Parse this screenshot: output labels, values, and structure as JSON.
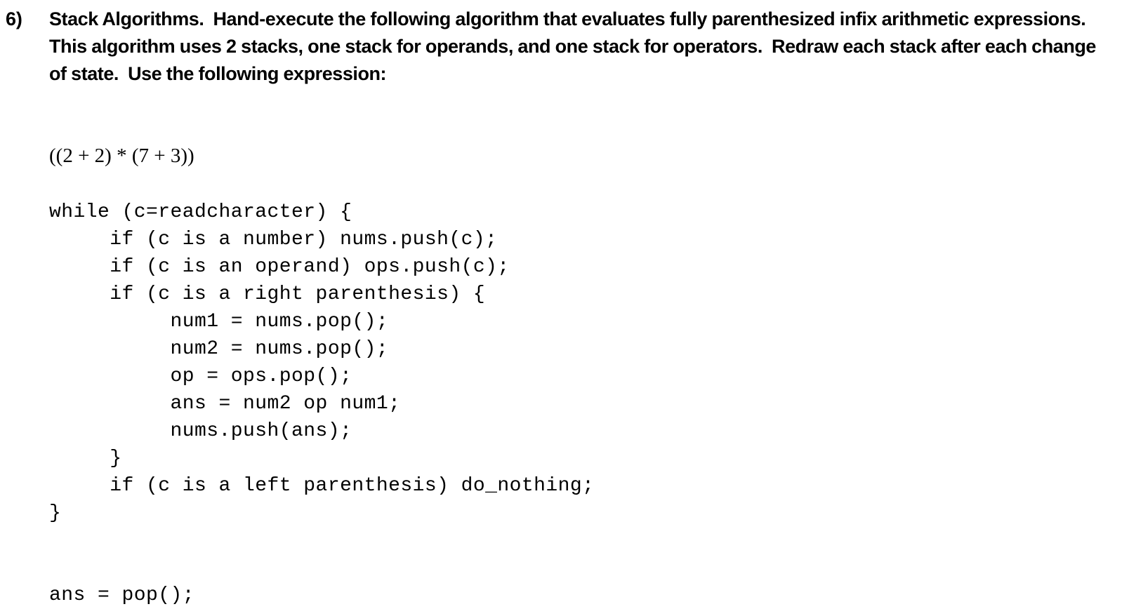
{
  "page": {
    "background_color": "#ffffff",
    "text_color": "#000000"
  },
  "question": {
    "number_label": "6)",
    "prompt": "Stack Algorithms.  Hand-execute the following algorithm that evaluates fully parenthesized infix arithmetic expressions.  This algorithm uses 2 stacks, one stack for operands, and one stack for operators.  Redraw each stack after each change of state.  Use the following expression:",
    "prompt_lines": [
      "Stack Algorithms.  Hand-execute the following algorithm that evaluates fully parenthesized",
      "infix arithmetic expressions.  This algorithm uses 2 stacks, one stack for operands, and one",
      "stack for operators.  Redraw each stack after each change of state.  Use the following",
      "expression:"
    ]
  },
  "expression": {
    "text": "((2 + 2) * (7 + 3))"
  },
  "code": {
    "lines": [
      "while (c=readcharacter) {",
      "     if (c is a number) nums.push(c);",
      "     if (c is an operand) ops.push(c);",
      "     if (c is a right parenthesis) {",
      "          num1 = nums.pop();",
      "          num2 = nums.pop();",
      "          op = ops.pop();",
      "          ans = num2 op num1;",
      "          nums.push(ans);",
      "     }",
      "     if (c is a left parenthesis) do_nothing;",
      "}",
      "",
      "",
      "ans = pop();"
    ]
  }
}
